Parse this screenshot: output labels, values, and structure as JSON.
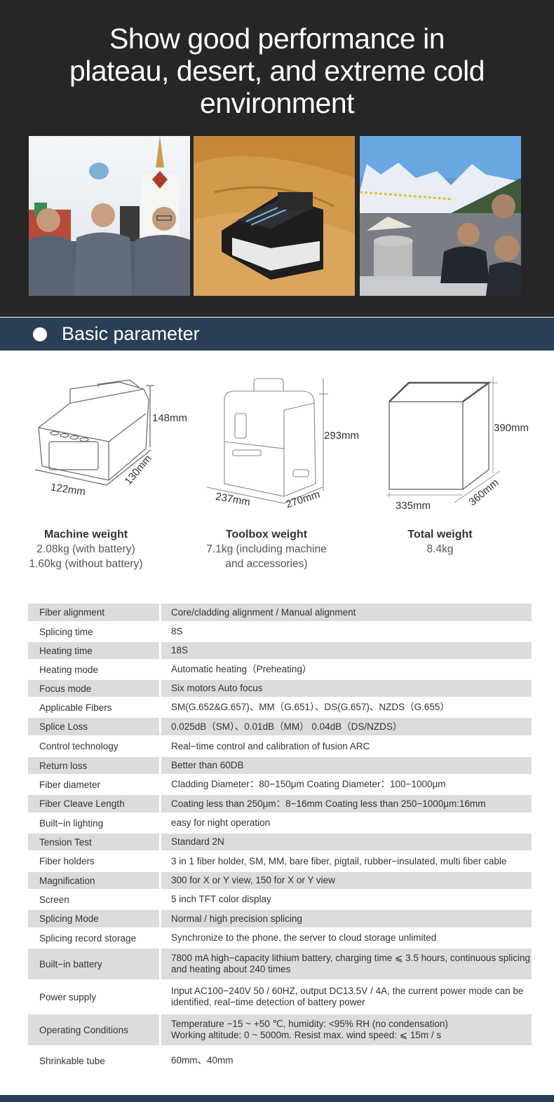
{
  "hero": {
    "title_lines": [
      "Show good performance in",
      "plateau, desert, and extreme cold",
      "environment"
    ],
    "photos": [
      {
        "name": "plateau-team-photo",
        "caption": "Three technicians in front of a white stupa"
      },
      {
        "name": "desert-splicer-photo",
        "caption": "Fusion splicer half-buried in sand"
      },
      {
        "name": "cold-mountain-photo",
        "caption": "Engineers working near snowy mountains"
      }
    ]
  },
  "section": {
    "title": "Basic  parameter"
  },
  "dimensions": {
    "machine": {
      "height": "148mm",
      "width": "122mm",
      "depth": "130mm"
    },
    "toolbox": {
      "height": "293mm",
      "width": "237mm",
      "depth": "270mm"
    },
    "total": {
      "height": "390mm",
      "width": "335mm",
      "depth": "360mm"
    }
  },
  "weights": [
    {
      "title": "Machine weight",
      "lines": [
        "2.08kg (with battery)",
        "1.60kg (without battery)"
      ]
    },
    {
      "title": "Toolbox weight",
      "lines": [
        "7.1kg (including machine",
        "and accessories)"
      ]
    },
    {
      "title": "Total weight",
      "lines": [
        "8.4kg"
      ]
    }
  ],
  "specs": [
    {
      "key": "Fiber alignment",
      "value": [
        "Core/cladding alignment  / Manual alignment"
      ]
    },
    {
      "key": "Splicing time",
      "value": [
        "8S"
      ]
    },
    {
      "key": "Heating time",
      "value": [
        "18S"
      ]
    },
    {
      "key": "Heating mode",
      "value": [
        "Automatic heating（Preheating）"
      ]
    },
    {
      "key": "Focus mode",
      "value": [
        "Six motors  Auto focus"
      ]
    },
    {
      "key": "Applicable Fibers",
      "value": [
        "SM(G.652&G.657)、MM（G.651）、DS(G.657)、NZDS（G.655）"
      ]
    },
    {
      "key": "Splice Loss",
      "value": [
        "0.025dB（SM）、0.01dB（MM） 0.04dB（DS/NZDS）"
      ]
    },
    {
      "key": "Control  technology",
      "value": [
        "Real−time control and calibration of fusion ARC"
      ]
    },
    {
      "key": "Return loss",
      "value": [
        "Better than 60DB"
      ]
    },
    {
      "key": "Fiber diameter",
      "value": [
        "Cladding Diameter：80−150μm   Coating Diameter：100−1000μm"
      ]
    },
    {
      "key": "Fiber Cleave Length",
      "value": [
        "Coating less than 250μm：8−16mm  Coating less than 250−1000μm:16mm"
      ]
    },
    {
      "key": "Built−in lighting",
      "value": [
        "easy for night operation"
      ]
    },
    {
      "key": "Tension Test",
      "value": [
        "Standard 2N"
      ]
    },
    {
      "key": "Fiber holders",
      "value": [
        "3 in 1 fiber holder, SM, MM, bare fiber, pigtail, rubber−insulated, multi fiber cable"
      ]
    },
    {
      "key": "Magnification",
      "value": [
        "300 for X or Y view, 150 for X or Y view"
      ]
    },
    {
      "key": "Screen",
      "value": [
        "5 inch TFT color display"
      ]
    },
    {
      "key": "Splicing Mode",
      "value": [
        "Normal / high precision splicing"
      ]
    },
    {
      "key": "Splicing record storage",
      "value": [
        "Synchronize to the phone, the server to cloud storage unlimited"
      ]
    },
    {
      "key": "Built−in battery",
      "value": [
        "7800 mA high−capacity lithium battery, charging time ⩽ 3.5 hours, continuous splicing",
        "and heating about 240 times"
      ]
    },
    {
      "key": "Power supply",
      "value": [
        "Input AC100−240V 50 / 60HZ, output DC13.5V / 4A, the current power mode can be",
        "identified, real−time detection of battery power"
      ]
    },
    {
      "key": "Operating Conditions",
      "value": [
        "Temperature −15 ~ +50 ℃, humidity: <95% RH (no condensation)",
        "Working altitude: 0 ~ 5000m. Resist max. wind speed: ⩽ 15m / s"
      ]
    },
    {
      "key": "Shrinkable   tube",
      "value": [
        "60mm、40mm"
      ]
    }
  ]
}
